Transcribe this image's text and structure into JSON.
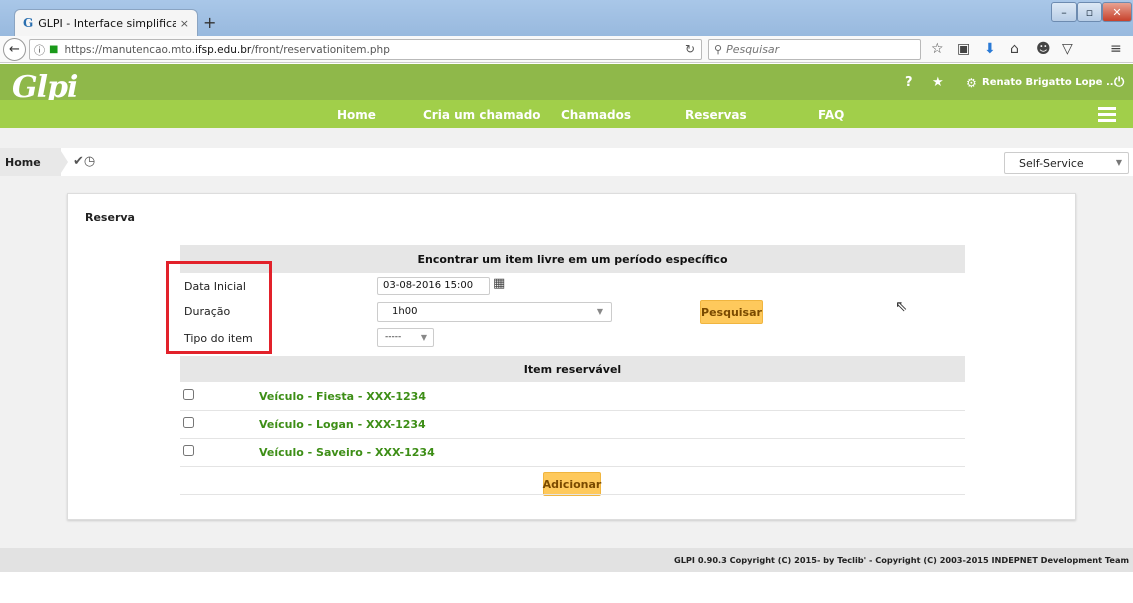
{
  "browser": {
    "tab_title": "GLPI - Interface simplificada",
    "tab_favicon": "G",
    "tab_close": "×",
    "new_tab": "+",
    "url_prefix": "https://manutencao.mto.",
    "url_domain": "ifsp.edu.br",
    "url_path": "/front/reservationitem.php",
    "search_placeholder": "Pesquisar"
  },
  "header": {
    "logo": "Glpi",
    "help": "?",
    "favorite": "★",
    "user_name": "Renato Brigatto Lope ...",
    "logout": "⏻"
  },
  "menu": {
    "items": [
      "Home",
      "Cria um chamado",
      "Chamados",
      "Reservas",
      "FAQ"
    ]
  },
  "breadcrumb": {
    "home": "Home",
    "profile": "Self-Service"
  },
  "card": {
    "title": "Reserva",
    "form_header": "Encontrar um item livre em um período específico",
    "labels": {
      "start_date": "Data Inicial",
      "duration": "Duração",
      "item_type": "Tipo do item"
    },
    "start_date_value": "03-08-2016 15:00",
    "duration_value": "1h00",
    "item_type_value": "-----",
    "search_button": "Pesquisar",
    "items_header": "Item reservável",
    "items": [
      "Veículo - Fiesta - XXX-1234",
      "Veículo - Logan - XXX-1234",
      "Veículo - Saveiro - XXX-1234"
    ],
    "add_button": "Adicionar"
  },
  "footer": {
    "text": "GLPI 0.90.3 Copyright (C) 2015- by Teclib' - Copyright (C) 2003-2015 INDEPNET Development Team"
  },
  "colors": {
    "header_dark": "#8fb84a",
    "menu_green": "#a1cf4a",
    "button_yellow": "#fec95c",
    "link_green": "#3d8e16",
    "highlight_red": "#e2212a"
  }
}
